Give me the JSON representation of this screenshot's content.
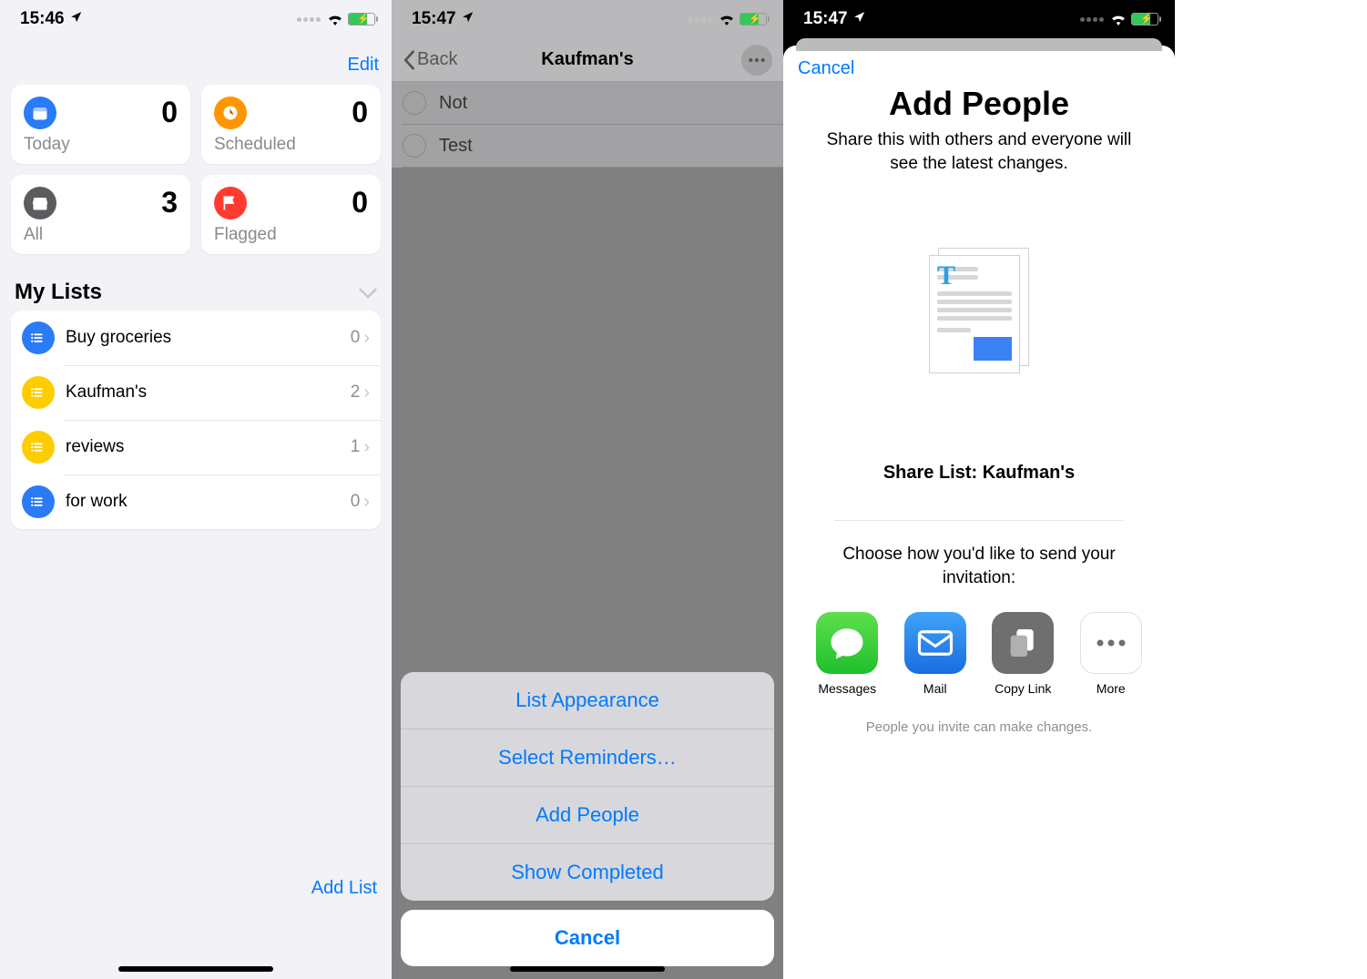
{
  "screen1": {
    "time": "15:46",
    "edit": "Edit",
    "cards": [
      {
        "label": "Today",
        "count": "0",
        "color": "#2a7bf6",
        "icon": "calendar"
      },
      {
        "label": "Scheduled",
        "count": "0",
        "color": "#ff9500",
        "icon": "clock"
      },
      {
        "label": "All",
        "count": "3",
        "color": "#5b5b60",
        "icon": "tray"
      },
      {
        "label": "Flagged",
        "count": "0",
        "color": "#ff3b30",
        "icon": "flag"
      }
    ],
    "my_lists_header": "My Lists",
    "lists": [
      {
        "title": "Buy groceries",
        "count": "0",
        "color": "#2a7bf6"
      },
      {
        "title": "Kaufman's",
        "count": "2",
        "color": "#ffcc00"
      },
      {
        "title": "reviews",
        "count": "1",
        "color": "#ffcc00"
      },
      {
        "title": "for work",
        "count": "0",
        "color": "#2a7bf6"
      }
    ],
    "add_list": "Add List"
  },
  "screen2": {
    "time": "15:47",
    "back": "Back",
    "title": "Kaufman's",
    "tasks": [
      {
        "text": "Not"
      },
      {
        "text": "Test"
      }
    ],
    "actions": [
      "List Appearance",
      "Select Reminders…",
      "Add People",
      "Show Completed"
    ],
    "cancel": "Cancel"
  },
  "screen3": {
    "time": "15:47",
    "cancel": "Cancel",
    "title": "Add People",
    "subtitle": "Share this with others and everyone will see the latest changes.",
    "share_list": "Share List: Kaufman's",
    "invite_text": "Choose how you'd like to send your invitation:",
    "share_items": [
      {
        "label": "Messages"
      },
      {
        "label": "Mail"
      },
      {
        "label": "Copy Link"
      },
      {
        "label": "More"
      }
    ],
    "footer": "People you invite can make changes."
  }
}
